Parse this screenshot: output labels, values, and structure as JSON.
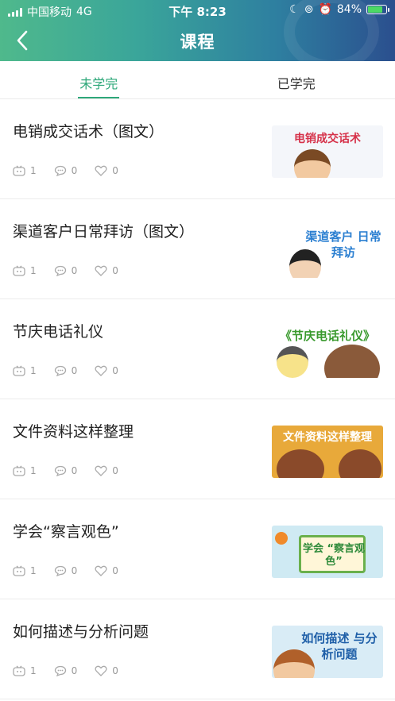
{
  "status": {
    "carrier": "中国移动",
    "network": "4G",
    "time": "下午 8:23",
    "battery": "84%"
  },
  "nav": {
    "title": "课程",
    "back_icon": "chevron-left-icon"
  },
  "tabs": [
    {
      "label": "未学完",
      "active": true
    },
    {
      "label": "已学完",
      "active": false
    }
  ],
  "courses": [
    {
      "title": "电销成交话术（图文）",
      "views": "1",
      "comments": "0",
      "likes": "0",
      "thumb_text": "电销成交话术"
    },
    {
      "title": "渠道客户日常拜访（图文）",
      "views": "1",
      "comments": "0",
      "likes": "0",
      "thumb_text": "渠道客户 日常拜访"
    },
    {
      "title": "节庆电话礼仪",
      "views": "1",
      "comments": "0",
      "likes": "0",
      "thumb_text": "《节庆电话礼仪》"
    },
    {
      "title": "文件资料这样整理",
      "views": "1",
      "comments": "0",
      "likes": "0",
      "thumb_text": "文件资料这样整理"
    },
    {
      "title": "学会“察言观色”",
      "views": "1",
      "comments": "0",
      "likes": "0",
      "thumb_text": "学会 “察言观色”"
    },
    {
      "title": "如何描述与分析问题",
      "views": "1",
      "comments": "0",
      "likes": "0",
      "thumb_text": "如何描述 与分析问题"
    }
  ],
  "colors": {
    "accent": "#2ea87a",
    "header_start": "#4fb98c",
    "header_end": "#2b4f8e",
    "meta_text": "#999999"
  }
}
